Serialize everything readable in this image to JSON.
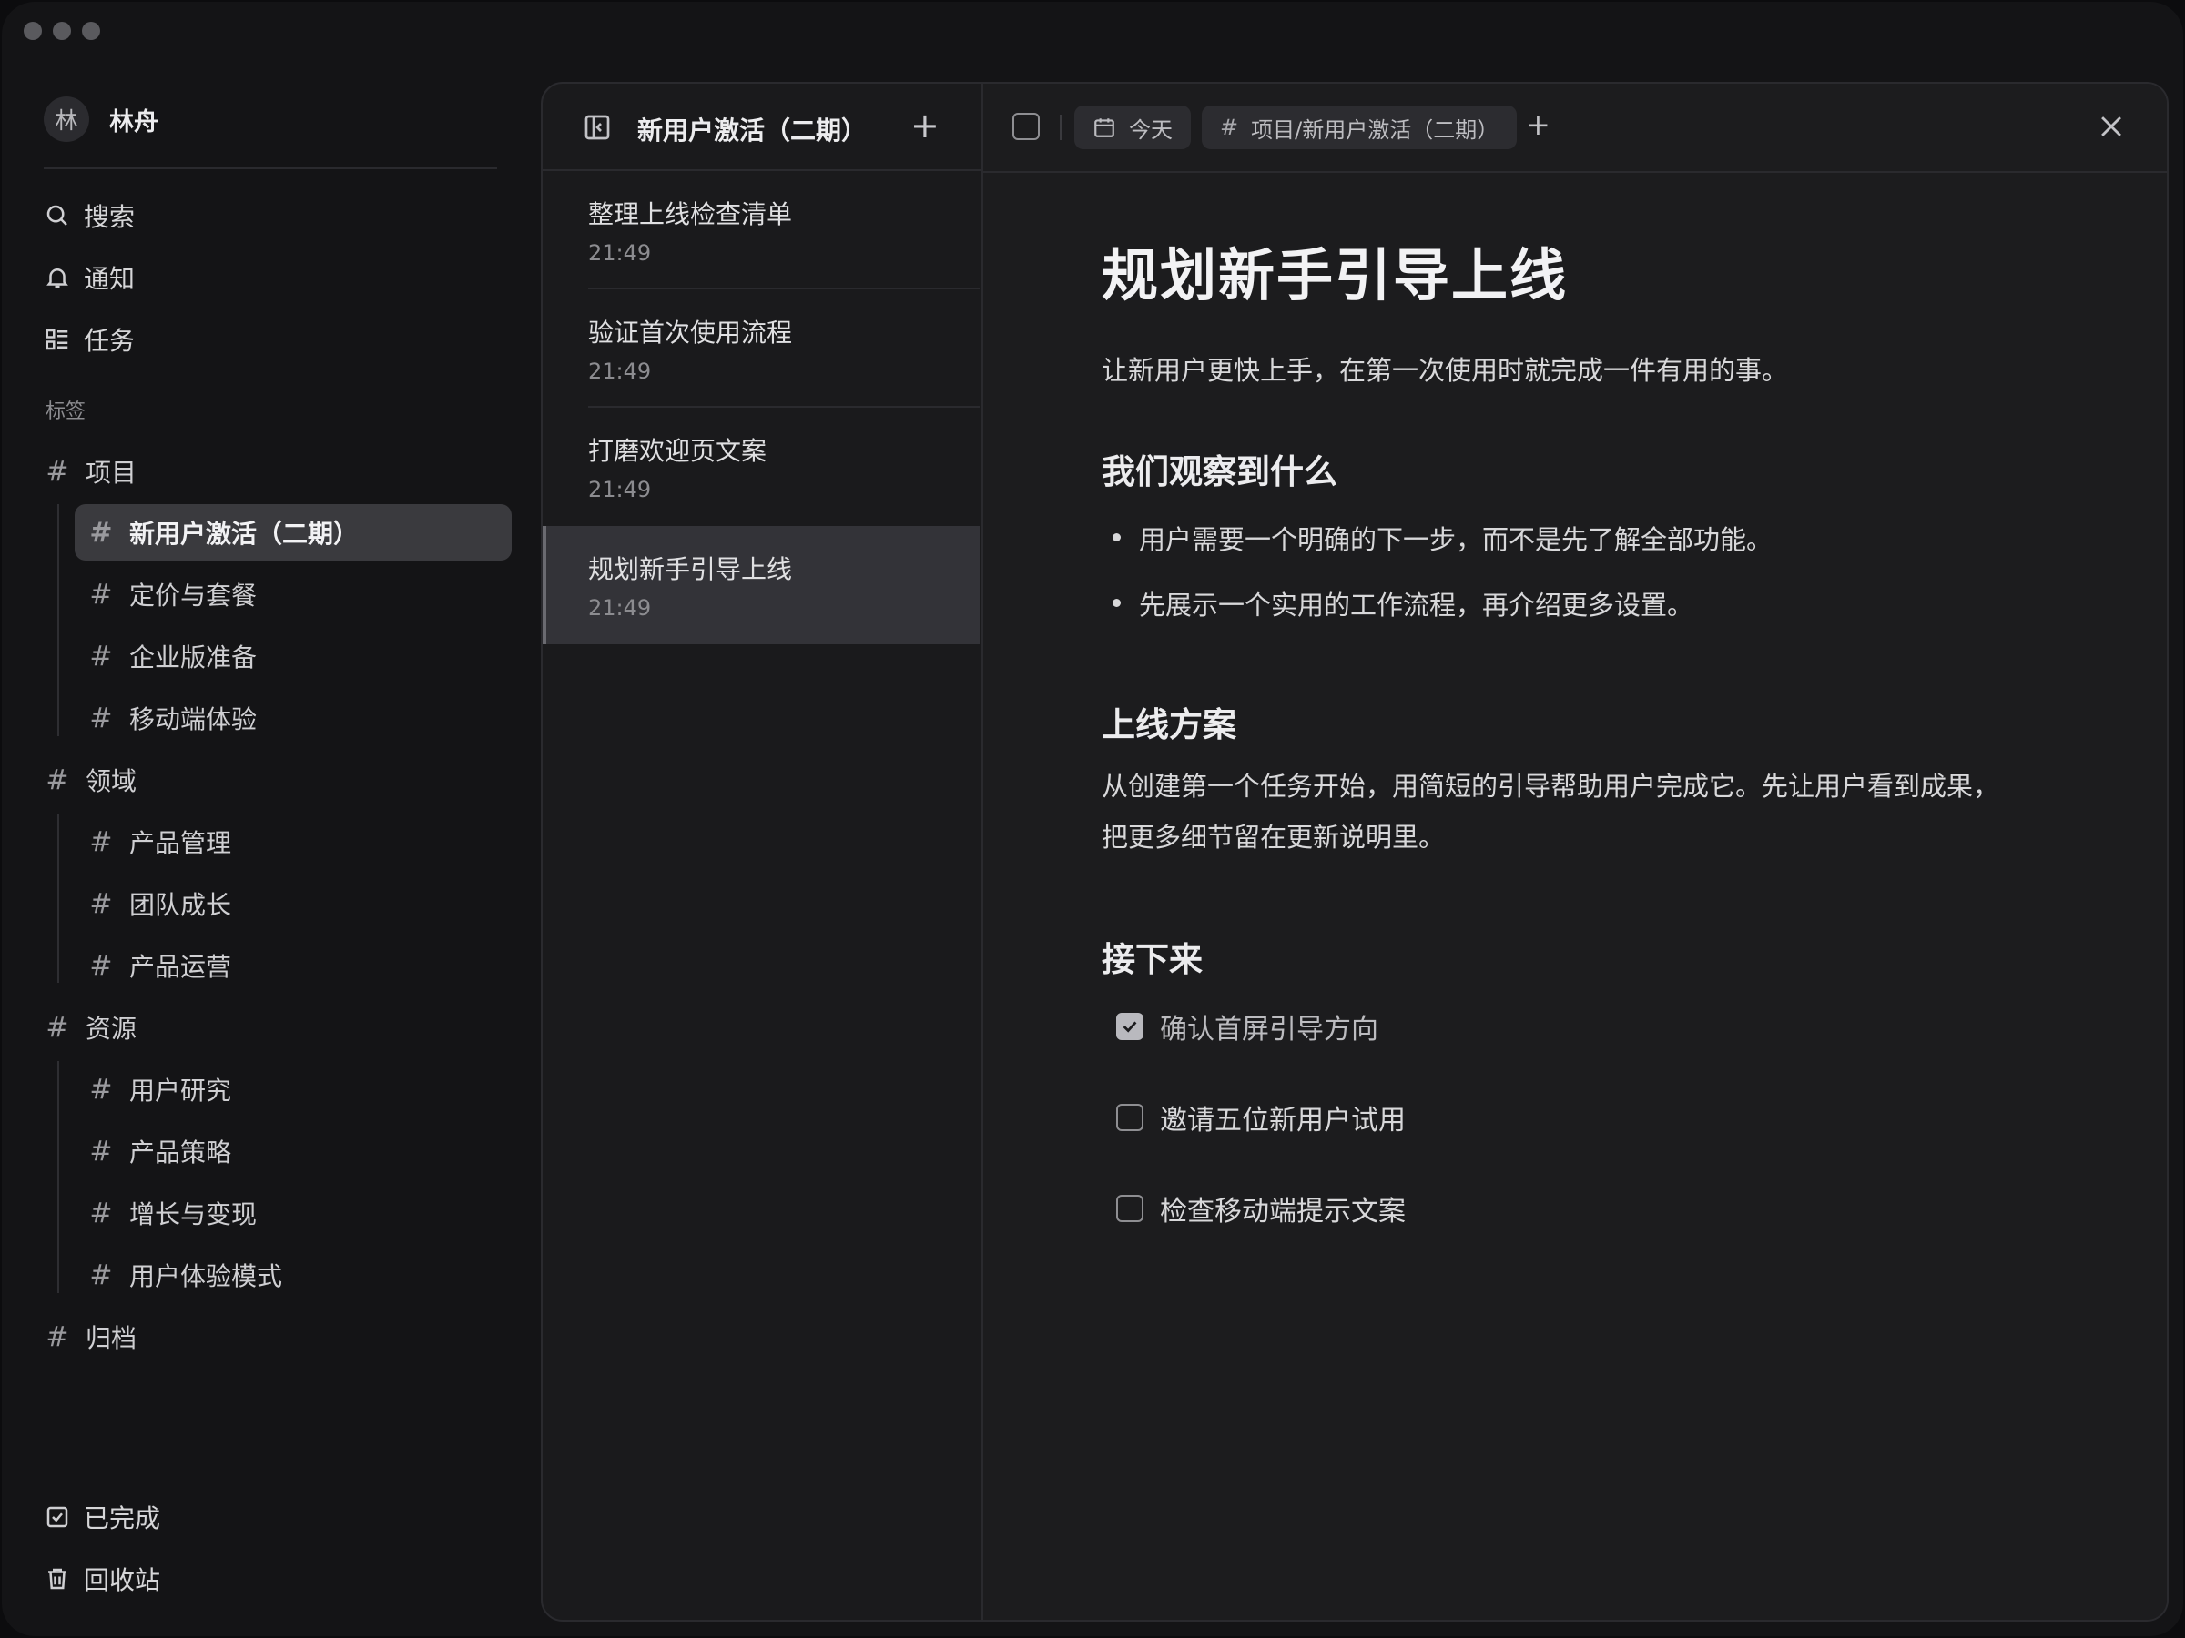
{
  "user": {
    "avatar_initial": "林",
    "name": "林舟"
  },
  "nav": {
    "search": "搜索",
    "notifications": "通知",
    "tasks": "任务"
  },
  "tags_section_label": "标签",
  "tag_groups": {
    "projects": {
      "label": "项目",
      "children": [
        "新用户激活（二期）",
        "定价与套餐",
        "企业版准备",
        "移动端体验"
      ]
    },
    "areas": {
      "label": "领域",
      "children": [
        "产品管理",
        "团队成长",
        "产品运营"
      ]
    },
    "resources": {
      "label": "资源",
      "children": [
        "用户研究",
        "产品策略",
        "增长与变现",
        "用户体验模式"
      ]
    },
    "archive": {
      "label": "归档"
    }
  },
  "bottom_nav": {
    "completed": "已完成",
    "trash": "回收站"
  },
  "list": {
    "title": "新用户激活（二期）",
    "add_symbol": "+",
    "items": [
      {
        "title": "整理上线检查清单",
        "time": "21:49"
      },
      {
        "title": "验证首次使用流程",
        "time": "21:49"
      },
      {
        "title": "打磨欢迎页文案",
        "time": "21:49"
      },
      {
        "title": "规划新手引导上线",
        "time": "21:49"
      }
    ]
  },
  "toolbar": {
    "date_chip": "今天",
    "tag_chip": "项目/新用户激活（二期）",
    "add_symbol": "+"
  },
  "document": {
    "title": "规划新手引导上线",
    "intro": "让新用户更快上手，在第一次使用时就完成一件有用的事。",
    "h_observed": "我们观察到什么",
    "bullets": [
      "用户需要一个明确的下一步，而不是先了解全部功能。",
      "先展示一个实用的工作流程，再介绍更多设置。"
    ],
    "h_plan": "上线方案",
    "plan_lines": [
      "从创建第一个任务开始，用简短的引导帮助用户完成它。先让用户看到成果，",
      "把更多细节留在更新说明里。"
    ],
    "h_next": "接下来",
    "todos": [
      {
        "label": "确认首屏引导方向",
        "checked": true
      },
      {
        "label": "邀请五位新用户试用",
        "checked": false
      },
      {
        "label": "检查移动端提示文案",
        "checked": false
      }
    ]
  }
}
